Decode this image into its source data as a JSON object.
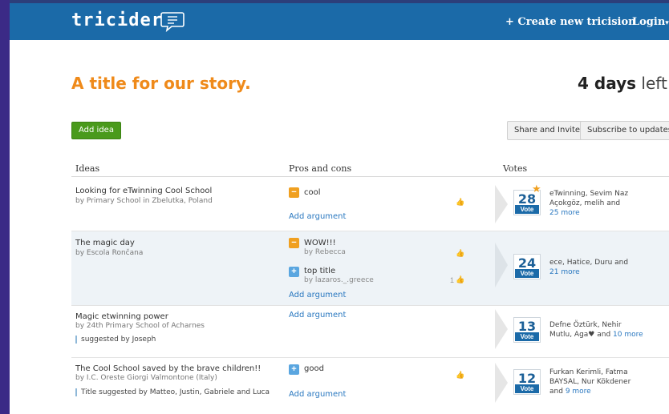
{
  "header": {
    "logo": "tricider",
    "create_label": "+ Create new tricision",
    "login_label": "Login",
    "login_caret": "▾"
  },
  "decision": {
    "title": "A title for our story.",
    "countdown_value": "4 days",
    "countdown_suffix": "left"
  },
  "toolbar": {
    "add_idea": "Add idea",
    "share": "Share and Invite",
    "subscribe": "Subscribe to updates"
  },
  "columns": {
    "ideas": "Ideas",
    "pros_cons": "Pros and cons",
    "votes": "Votes"
  },
  "add_argument_label": "Add argument",
  "vote_label": "Vote",
  "ideas": [
    {
      "title": "Looking for eTwinning Cool School",
      "by": "by Primary School in Zbelutka, Poland",
      "arguments": [
        {
          "type": "con",
          "text": "cool"
        }
      ],
      "votes": "28",
      "voters_line1": "eTwinning, Sevim Naz",
      "voters_line2": "Açokgöz, melih and",
      "voters_more": "25 more"
    },
    {
      "title": "The magic day",
      "by": "by Escola Rončana",
      "arguments": [
        {
          "type": "con",
          "text": "WOW!!!",
          "by": "by Rebecca"
        },
        {
          "type": "pro",
          "text": "top title",
          "by": "by lazaros._.greece",
          "likes": "1"
        }
      ],
      "votes": "24",
      "voters_line1": "ece, Hatice, Duru and",
      "voters_more": "21 more"
    },
    {
      "title": "Magic etwinning power",
      "by": "by 24th Primary School of Acharnes",
      "suggested": "suggested by Joseph",
      "votes": "13",
      "voters_line1": "Defne Öztürk, Nehir",
      "voters_line2a": "Mutlu, Aga♥ and",
      "voters_more": "10 more"
    },
    {
      "title": "The Cool School saved by the brave children!!",
      "by": "by I.C. Oreste Giorgi Valmontone (Italy)",
      "suggested": "Title suggested by Matteo, Justin, Gabriele and Luca",
      "arguments": [
        {
          "type": "pro",
          "text": "good"
        }
      ],
      "votes": "12",
      "voters_line1": "Furkan Kerimli, Fatma",
      "voters_line2": "BAYSAL, Nur Kökdener",
      "voters_line3a": "and",
      "voters_more": "9 more"
    }
  ],
  "colors": {
    "header_blue": "#1b6aa8",
    "title_orange": "#ef8a1a",
    "add_green": "#4a9a1c",
    "link_blue": "#2a78c0",
    "frame_purple": "#3b2a86"
  }
}
